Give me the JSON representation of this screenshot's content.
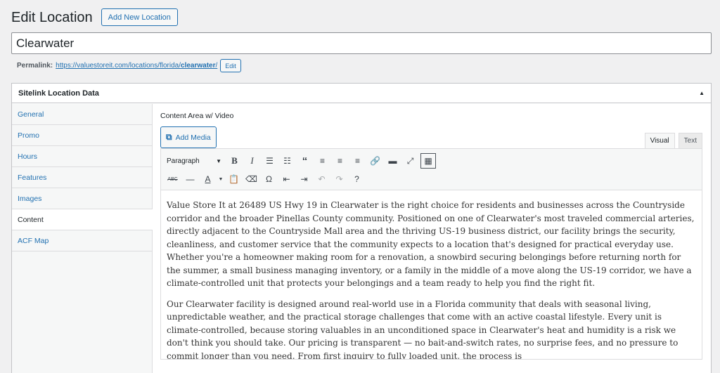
{
  "header": {
    "title": "Edit Location",
    "add_new_label": "Add New Location"
  },
  "post_title": "Clearwater",
  "permalink": {
    "label": "Permalink:",
    "url_base": "https://valuestoreit.com/locations/florida/",
    "slug": "clearwater",
    "url_end": "/",
    "edit_label": "Edit"
  },
  "metabox": {
    "title": "Sitelink Location Data",
    "tabs": [
      "General",
      "Promo",
      "Hours",
      "Features",
      "Images",
      "Content",
      "ACF Map"
    ],
    "active_tab": "Content"
  },
  "field": {
    "label": "Content Area w/ Video",
    "add_media_label": "Add Media",
    "mode_visual": "Visual",
    "mode_text": "Text",
    "format_value": "Paragraph"
  },
  "toolbar_icons": {
    "row1": [
      "bold-icon",
      "italic-icon",
      "bullet-list-icon",
      "numbered-list-icon",
      "blockquote-icon",
      "align-left-icon",
      "align-center-icon",
      "align-right-icon",
      "link-icon",
      "read-more-icon",
      "fullscreen-icon",
      "toolbar-toggle-icon"
    ],
    "row2": [
      "strikethrough-icon",
      "horizontal-line-icon",
      "text-color-icon",
      "paste-text-icon",
      "clear-formatting-icon",
      "special-character-icon",
      "outdent-icon",
      "indent-icon",
      "undo-icon",
      "redo-icon",
      "help-icon"
    ]
  },
  "content": {
    "p1": "Value Store It at 26489 US Hwy 19 in Clearwater is the right choice for residents and businesses across the Countryside corridor and the broader Pinellas County community. Positioned on one of Clearwater's most traveled commercial arteries, directly adjacent to the Countryside Mall area and the thriving US-19 business district, our facility brings the security, cleanliness, and customer service that the community expects to a location that's designed for practical everyday use. Whether you're a homeowner making room for a renovation, a snowbird securing belongings before returning north for the summer, a small business managing inventory, or a family in the middle of a move along the US-19 corridor, we have a climate-controlled unit that protects your belongings and a team ready to help you find the right fit.",
    "p2": "Our Clearwater facility is designed around real-world use in a Florida community that deals with seasonal living, unpredictable weather, and the practical storage challenges that come with an active coastal lifestyle. Every unit is climate-controlled, because storing valuables in an unconditioned space in Clearwater's heat and humidity is a risk we don't think you should take. Our pricing is transparent — no bait-and-switch rates, no surprise fees, and no pressure to commit longer than you need. From first inquiry to fully loaded unit, the process is"
  }
}
